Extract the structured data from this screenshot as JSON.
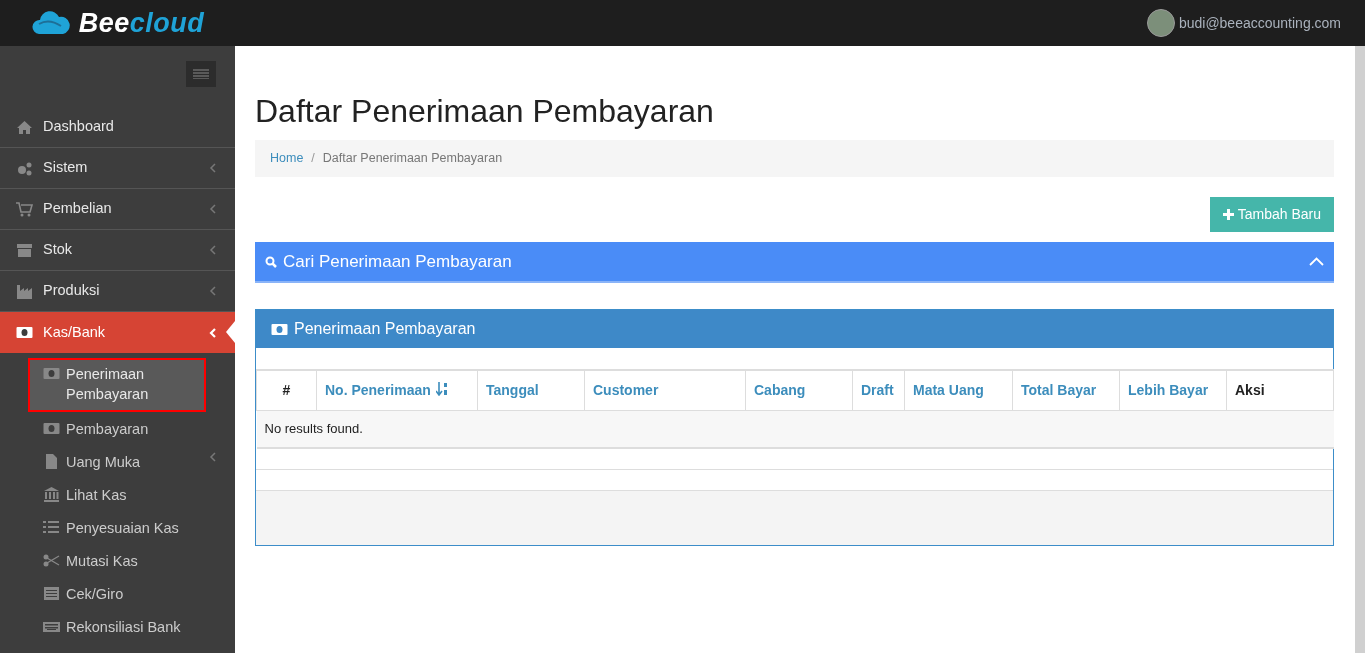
{
  "brand": {
    "first": "Bee",
    "second": "cloud"
  },
  "user": {
    "email": "budi@beeaccounting.com"
  },
  "sidebar": {
    "items": [
      {
        "label": "Dashboard",
        "has_submenu": false,
        "selected": false
      },
      {
        "label": "Sistem",
        "has_submenu": true,
        "selected": false
      },
      {
        "label": "Pembelian",
        "has_submenu": true,
        "selected": false
      },
      {
        "label": "Stok",
        "has_submenu": true,
        "selected": false
      },
      {
        "label": "Produksi",
        "has_submenu": true,
        "selected": false
      },
      {
        "label": "Kas/Bank",
        "has_submenu": true,
        "selected": true,
        "children": [
          {
            "label": "Penerimaan Pembayaran",
            "has_submenu": false,
            "selected": true,
            "outlined": true
          },
          {
            "label": "Pembayaran",
            "has_submenu": false,
            "selected": false,
            "outlined": false
          },
          {
            "label": "Uang Muka",
            "has_submenu": true,
            "selected": false,
            "outlined": false
          },
          {
            "label": "Lihat Kas",
            "has_submenu": false,
            "selected": false,
            "outlined": false
          },
          {
            "label": "Penyesuaian Kas",
            "has_submenu": false,
            "selected": false,
            "outlined": false
          },
          {
            "label": "Mutasi Kas",
            "has_submenu": false,
            "selected": false,
            "outlined": false
          },
          {
            "label": "Cek/Giro",
            "has_submenu": false,
            "selected": false,
            "outlined": false
          },
          {
            "label": "Rekonsiliasi Bank",
            "has_submenu": false,
            "selected": false,
            "outlined": false
          }
        ]
      }
    ]
  },
  "page": {
    "title": "Daftar Penerimaan Pembayaran"
  },
  "breadcrumb_separator": "/",
  "breadcrumb": [
    {
      "label": "Home",
      "kind": "link"
    },
    {
      "label": "Daftar Penerimaan Pembayaran",
      "kind": "current"
    }
  ],
  "add_button": {
    "label": "Tambah Baru"
  },
  "search_panel": {
    "title": "Cari Penerimaan Pembayaran",
    "expanded": true
  },
  "table_panel": {
    "title": "Penerimaan Pembayaran"
  },
  "table": {
    "columns": [
      {
        "label": "#",
        "link": false,
        "sorted": false
      },
      {
        "label": "No. Penerimaan",
        "link": true,
        "sorted": true
      },
      {
        "label": "Tanggal",
        "link": true,
        "sorted": false
      },
      {
        "label": "Customer",
        "link": true,
        "sorted": false
      },
      {
        "label": "Cabang",
        "link": true,
        "sorted": false
      },
      {
        "label": "Draft",
        "link": true,
        "sorted": false
      },
      {
        "label": "Mata Uang",
        "link": true,
        "sorted": false
      },
      {
        "label": "Total Bayar",
        "link": true,
        "sorted": false
      },
      {
        "label": "Lebih Bayar",
        "link": true,
        "sorted": false
      },
      {
        "label": "Aksi",
        "link": false,
        "sorted": false
      }
    ],
    "empty_message": "No results found."
  }
}
